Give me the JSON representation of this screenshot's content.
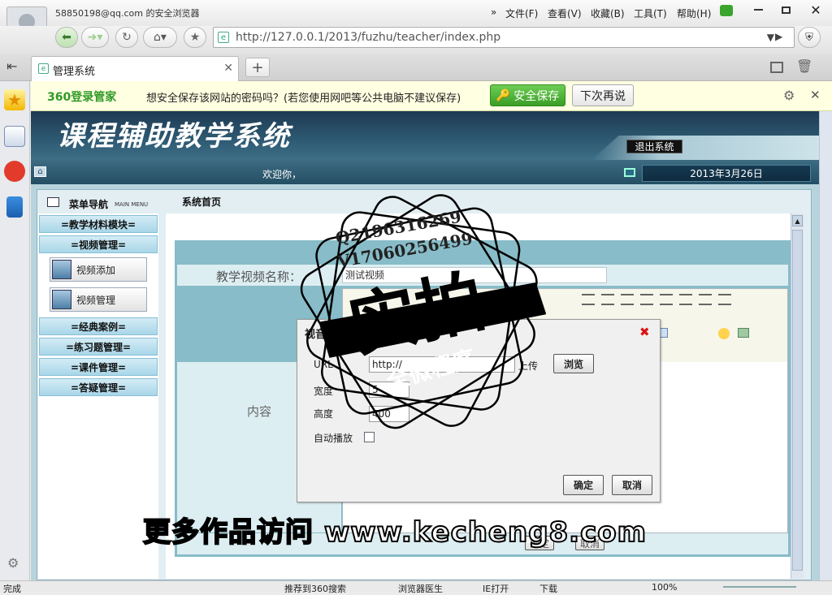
{
  "browser": {
    "account": "58850198@qq.com 的安全浏览器",
    "menu": [
      "文件(F)",
      "查看(V)",
      "收藏(B)",
      "工具(T)",
      "帮助(H)"
    ],
    "url": "http://127.0.0.1/2013/fuzhu/teacher/index.php",
    "tab_title": "管理系统"
  },
  "password_bar": {
    "brand": "360登录管家",
    "message": "想安全保存该网站的密码吗？(若您使用网吧等公共电脑不建议保存)",
    "save_label": "安全保存",
    "later_label": "下次再说"
  },
  "site": {
    "title": "课程辅助教学系统",
    "logout_label": "退出系统",
    "welcome": "欢迎你，",
    "date": "2013年3月26日",
    "menu_nav_label": "菜单导航",
    "menu_nav_en": "MAIN MENU",
    "breadcrumb": "系统首页"
  },
  "menu": {
    "sections": [
      {
        "label": "=教学材料模块="
      },
      {
        "label": "=视频管理="
      },
      {
        "label": "=经典案例="
      },
      {
        "label": "=练习题管理="
      },
      {
        "label": "=课件管理="
      },
      {
        "label": "=答疑管理="
      }
    ],
    "video_items": [
      {
        "label": "视频添加"
      },
      {
        "label": "视频管理"
      }
    ]
  },
  "form": {
    "name_label": "教学视频名称：",
    "name_value": "测试视频",
    "content_label": "内容",
    "submit_label": "确定",
    "cancel_label": "取消"
  },
  "dialog": {
    "title": "视音频",
    "url_label": "URL",
    "url_value": "http://",
    "upload_label": "上传",
    "browse_label": "浏览",
    "width_label": "宽度",
    "width_value": "5",
    "height_label": "高度",
    "height_value": "400",
    "autoplay_label": "自动播放",
    "ok_label": "确定",
    "cancel_label": "取消"
  },
  "statusbar": {
    "status": "完成",
    "items": [
      "推荐到360搜索",
      "浏览器医生",
      "IE打开",
      "下载"
    ],
    "zoom": "100%"
  },
  "watermark": {
    "qq": "Q2196316269",
    "v": "V17060256499",
    "big": "实拍",
    "ribbon": "全微程序",
    "bottom": "更多作品访问 www.kecheng8.com"
  },
  "colors": {
    "header_dark": "#1e3a52",
    "menu_head": "#a9d6e8",
    "panel": "#87bcc8",
    "save_green": "#3a9e26"
  }
}
